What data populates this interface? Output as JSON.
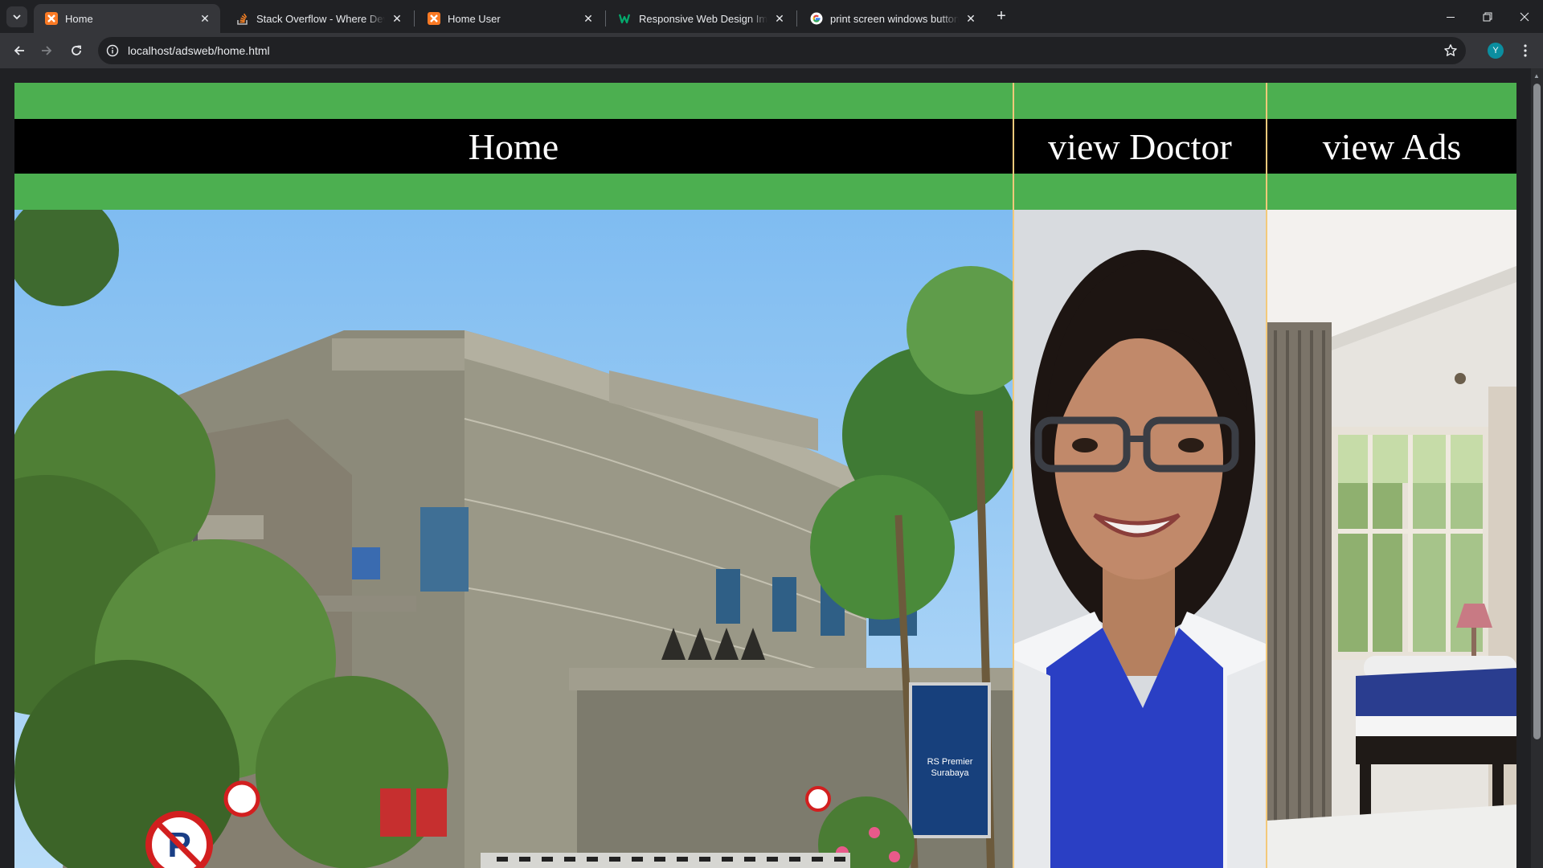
{
  "browser": {
    "tabs": [
      {
        "title": "Home",
        "favicon": "xampp-icon",
        "active": true
      },
      {
        "title": "Stack Overflow - Where Develo",
        "favicon": "stackoverflow-icon",
        "active": false
      },
      {
        "title": "Home User",
        "favicon": "xampp-icon",
        "active": false
      },
      {
        "title": "Responsive Web Design Images",
        "favicon": "w3schools-icon",
        "active": false
      },
      {
        "title": "print screen windows button - (",
        "favicon": "google-icon",
        "active": false
      }
    ],
    "url": "localhost/adsweb/home.html",
    "profile_initial": "Y",
    "colors": {
      "frame": "#202124",
      "toolbar": "#35363a",
      "profile": "#0b8ea0"
    }
  },
  "page": {
    "colors": {
      "nav_green": "#4caf50",
      "nav_black": "#000000",
      "divider": "#f3c97a"
    },
    "nav": [
      {
        "label": "Home",
        "image": "hospital-building-photo"
      },
      {
        "label": "view Doctor",
        "image": "doctor-portrait-photo"
      },
      {
        "label": "view Ads",
        "image": "hospital-room-photo"
      }
    ],
    "hospital_sign": [
      "RS Premier",
      "Surabaya"
    ]
  }
}
